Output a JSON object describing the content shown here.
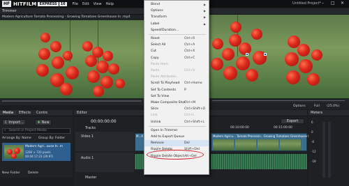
{
  "app": {
    "logo_mark": "HF",
    "brand": "HITFILM",
    "brand_sub": "EXPRESS",
    "version": "16",
    "window_title": "Untitled Project*",
    "menus": [
      "File",
      "Edit",
      "View",
      "Help"
    ],
    "window_controls": [
      "–",
      "□",
      "✕"
    ]
  },
  "trimmer": {
    "title": "Trimmer",
    "media_name": "Modern Agriculture Tomato Processing - Growing Tomatoes Greenhouse In .mp4",
    "transport": [
      "|◀",
      "◀◀",
      "◀|",
      "▶",
      "|▶",
      "▶▶",
      "▶|"
    ]
  },
  "viewer": {
    "options_label": "Options",
    "full_label": "Full",
    "zoom_label": "(25.0%)"
  },
  "media_panel": {
    "tabs": [
      "Media",
      "Effects",
      "Controls"
    ],
    "import_label": "Import...",
    "new_label": "New",
    "search_placeholder": "Search in Project Media",
    "arrange_label": "Arrange By: Name",
    "group_label": "Group By: Folder",
    "item_name": "Modern Agri...ouse In .m",
    "item_meta1": "1280 × 720 pixels",
    "item_meta2": "00:04:17:23 (29.97)",
    "new_folder_label": "New Folder",
    "delete_label": "Delete"
  },
  "editor": {
    "title": "Editor",
    "timecode": "00:00:00:00",
    "tracks_label": "Tracks",
    "video_track": "Video 1",
    "audio_track": "Audio 1",
    "master_label": "Master",
    "export_label": "Export",
    "ruler": [
      "00:10:00:00",
      "00:15:00:00"
    ],
    "clip_name": "M...4",
    "clip_full": "Modern Agricu... Tomato Processin...Growing Tomatoes Greenhouse In .mp4"
  },
  "meters": {
    "title": "Meters",
    "scale": [
      "6",
      "0",
      "-6",
      "-12",
      "-18"
    ]
  },
  "context_menu": {
    "items": [
      {
        "label": "Blend",
        "shortcut": "",
        "arrow": true,
        "disabled": false
      },
      {
        "label": "Options",
        "shortcut": "",
        "arrow": true,
        "disabled": false
      },
      {
        "label": "Transform",
        "shortcut": "",
        "arrow": true,
        "disabled": false
      },
      {
        "label": "Label",
        "shortcut": "",
        "arrow": true,
        "disabled": false
      },
      {
        "label": "Speed/Duration...",
        "shortcut": "",
        "arrow": false,
        "disabled": false
      },
      {
        "sep": true
      },
      {
        "label": "Reset",
        "shortcut": "Ctrl+R",
        "arrow": false,
        "disabled": false
      },
      {
        "label": "Select All",
        "shortcut": "Ctrl+A",
        "arrow": false,
        "disabled": false
      },
      {
        "label": "Cut",
        "shortcut": "Ctrl+X",
        "arrow": false,
        "disabled": false
      },
      {
        "label": "Copy",
        "shortcut": "Ctrl+C",
        "arrow": false,
        "disabled": false
      },
      {
        "label": "Paste Here",
        "shortcut": "",
        "arrow": false,
        "disabled": true
      },
      {
        "label": "Paste",
        "shortcut": "Ctrl+V",
        "arrow": false,
        "disabled": true
      },
      {
        "label": "Paste Attributes...",
        "shortcut": "",
        "arrow": false,
        "disabled": true
      },
      {
        "label": "Scroll To Playhead",
        "shortcut": "Ctrl+Home",
        "arrow": false,
        "disabled": false
      },
      {
        "label": "Set To Contents",
        "shortcut": "P",
        "arrow": false,
        "disabled": false
      },
      {
        "label": "Set To View",
        "shortcut": "",
        "arrow": false,
        "disabled": false
      },
      {
        "label": "Make Composite Shot",
        "shortcut": "Ctrl+M",
        "arrow": false,
        "disabled": false
      },
      {
        "label": "Slice",
        "shortcut": "Ctrl+Shift+D",
        "arrow": false,
        "disabled": false
      },
      {
        "label": "Link",
        "shortcut": "Ctrl+L",
        "arrow": false,
        "disabled": true
      },
      {
        "label": "Unlink",
        "shortcut": "Ctrl+Shift+L",
        "arrow": false,
        "disabled": false
      },
      {
        "sep": true
      },
      {
        "label": "Open In Trimmer",
        "shortcut": "",
        "arrow": false,
        "disabled": false
      },
      {
        "label": "Add to Export Queue",
        "shortcut": "",
        "arrow": false,
        "disabled": false
      },
      {
        "label": "Remove",
        "shortcut": "Del",
        "arrow": false,
        "disabled": false
      },
      {
        "label": "Ripple Delete",
        "shortcut": "Shift+Del",
        "arrow": false,
        "disabled": false
      },
      {
        "label": "Ripple Delete Object",
        "shortcut": "Alt+Del",
        "arrow": false,
        "disabled": false
      }
    ]
  }
}
